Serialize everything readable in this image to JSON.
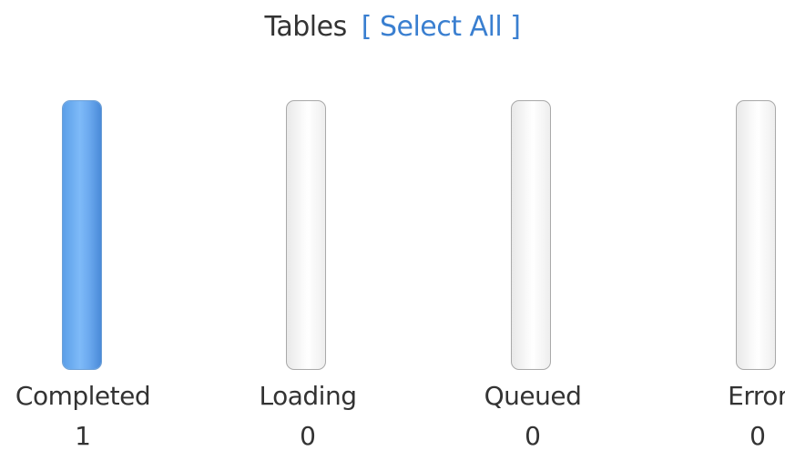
{
  "header": {
    "title": "Tables",
    "select_all": "[ Select All ]"
  },
  "statuses": [
    {
      "label": "Completed",
      "count": "1",
      "level": 1,
      "color": "#6aaaf2"
    },
    {
      "label": "Loading",
      "count": "0",
      "level": 0,
      "color": "#f3f3f3"
    },
    {
      "label": "Queued",
      "count": "0",
      "level": 0,
      "color": "#f3f3f3"
    },
    {
      "label": "Error",
      "count": "0",
      "level": 0,
      "color": "#f3f3f3"
    }
  ]
}
